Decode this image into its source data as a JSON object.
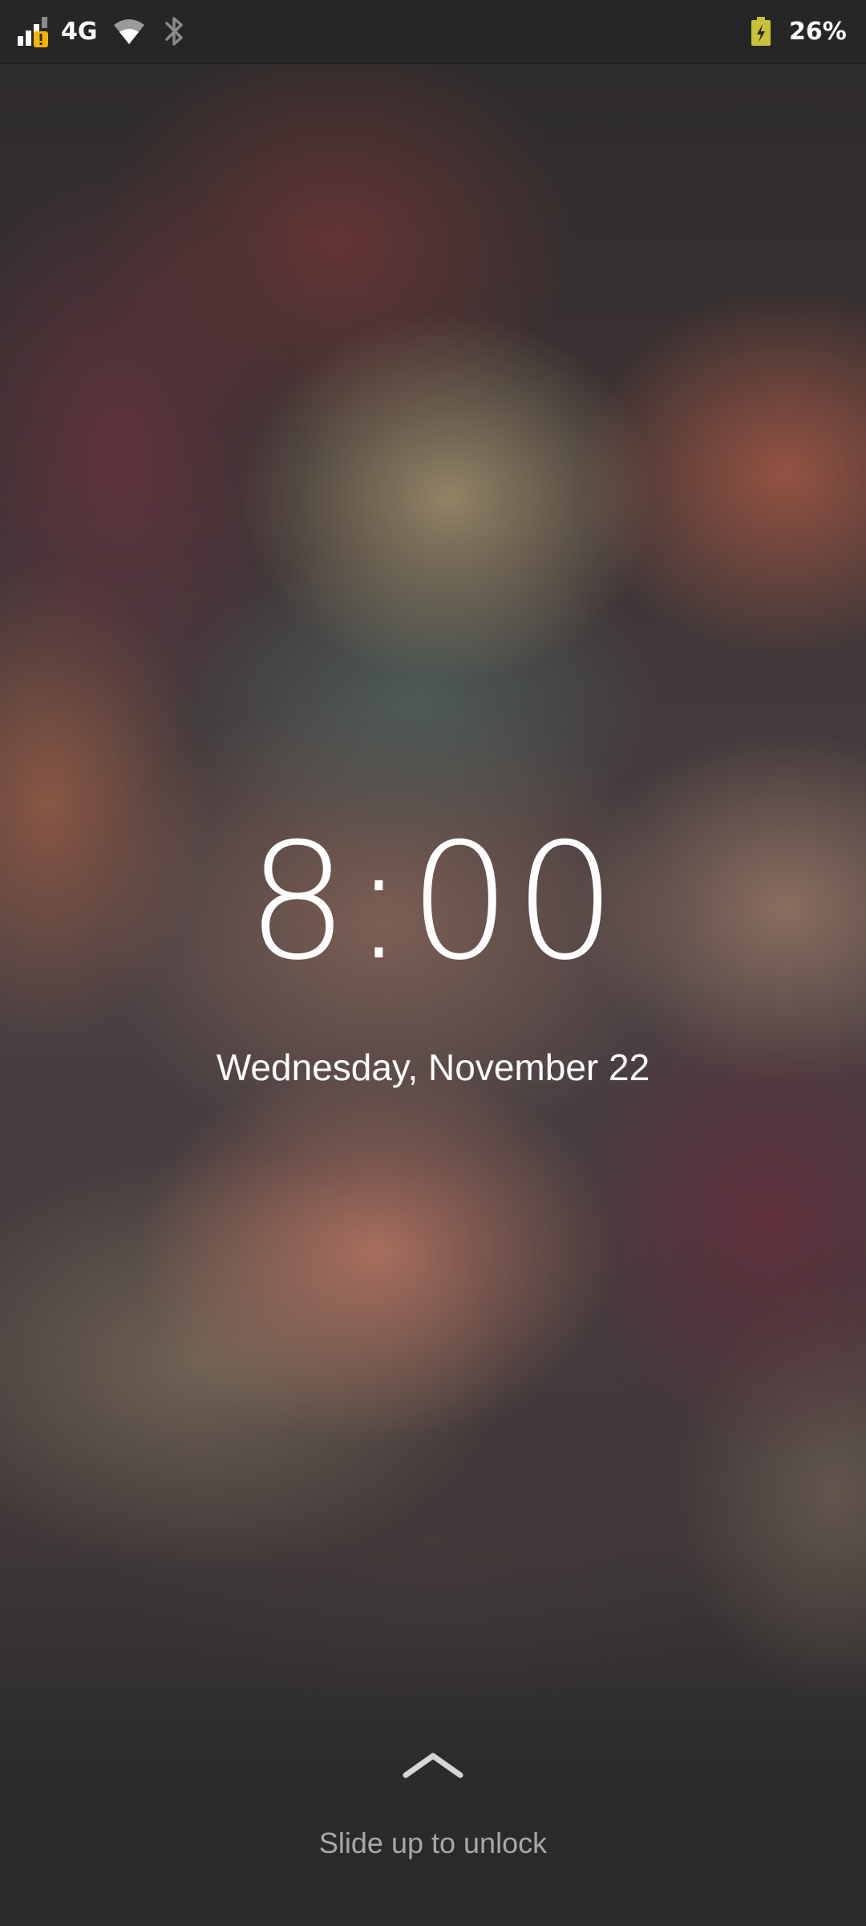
{
  "status_bar": {
    "network_type": "4G",
    "battery_percent": "26%",
    "icons": [
      "signal-icon",
      "wifi-icon",
      "bluetooth-icon",
      "battery-charging-icon"
    ],
    "colors": {
      "signal_warning": "#f5b400",
      "battery": "#c8c23a"
    }
  },
  "lockscreen": {
    "time": "8:00",
    "date": "Wednesday, November 22",
    "unlock_hint": "Slide up to unlock",
    "unlock_icon": "chevron-up-icon"
  }
}
